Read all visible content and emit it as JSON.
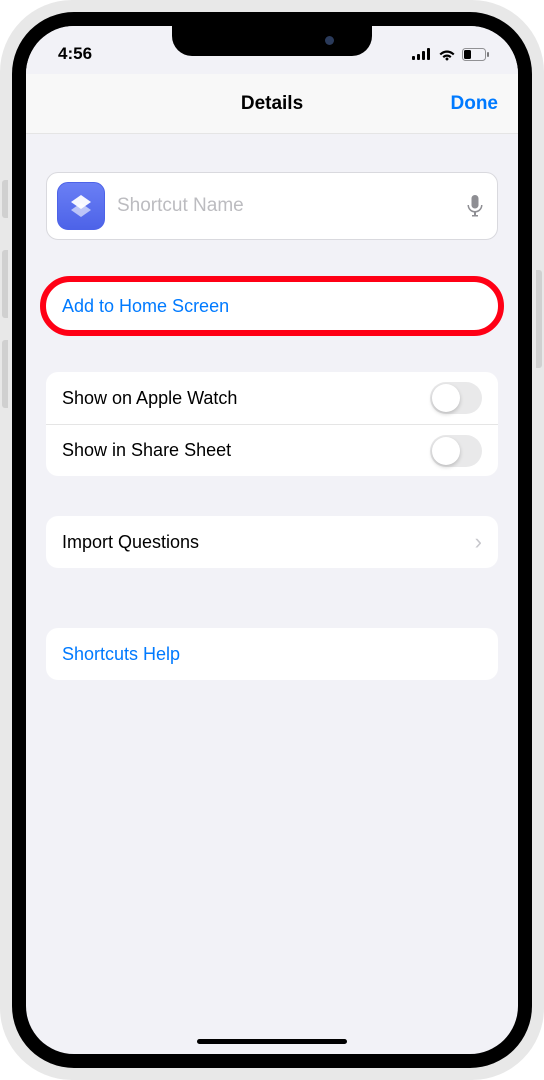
{
  "status": {
    "time": "4:56"
  },
  "header": {
    "title": "Details",
    "done": "Done"
  },
  "name_field": {
    "placeholder": "Shortcut Name"
  },
  "actions": {
    "add_home": "Add to Home Screen"
  },
  "toggles": {
    "apple_watch": "Show on Apple Watch",
    "share_sheet": "Show in Share Sheet"
  },
  "import_row": {
    "label": "Import Questions"
  },
  "help": {
    "label": "Shortcuts Help"
  }
}
